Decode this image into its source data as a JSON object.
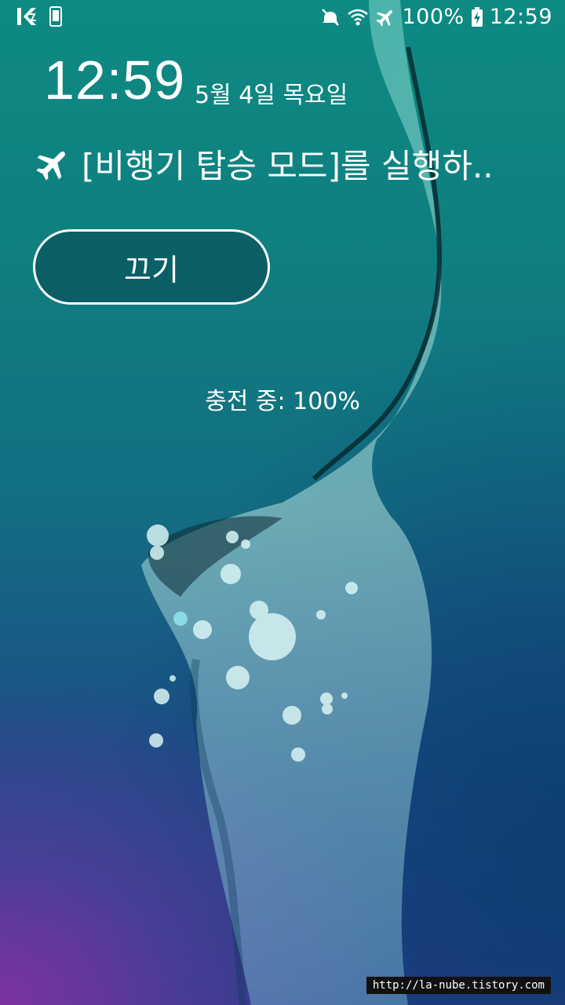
{
  "status_bar": {
    "left_icons": [
      "vpn-k-icon",
      "phone-screen-icon"
    ],
    "right_icons": [
      "mute-icon",
      "wifi-icon",
      "airplane-icon",
      "battery-charging-icon"
    ],
    "battery": "100%",
    "time": "12:59"
  },
  "lockscreen": {
    "clock": "12:59",
    "date": "5월 4일 목요일",
    "notice_icon": "airplane-icon",
    "notice_text": "[비행기 탑승 모드]를 실행하..",
    "off_button_label": "끄기",
    "charging_text": "충전 중: 100%"
  },
  "watermark": "http://la-nube.tistory.com",
  "colors": {
    "top_teal": "#0d8a82",
    "bottom_purple": "#8232a0",
    "text": "#ffffff"
  }
}
